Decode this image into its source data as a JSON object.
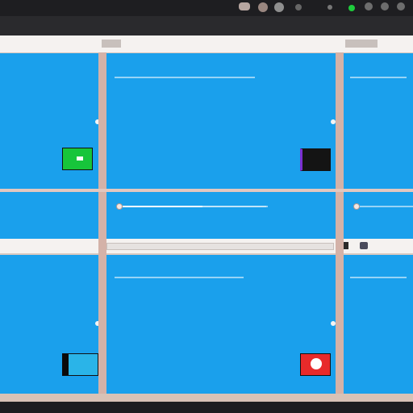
{
  "window": {
    "title_left": "",
    "title_right": ""
  },
  "panes": {
    "top_left": {
      "caption": "",
      "thumb_color": "#17c53b"
    },
    "top_middle": {
      "caption": "",
      "thumb_color": "#141414"
    },
    "bottom_middle": {
      "caption": "",
      "thumb_color": "#e82a2a"
    },
    "bottom_left": {
      "caption": "",
      "thumb_color": "#2ab4e8"
    },
    "right_top": {
      "caption": ""
    },
    "right_bottom": {
      "caption": ""
    }
  },
  "scrubber": {
    "label": "",
    "progress": 0.55
  },
  "toolbar": {
    "label": ""
  },
  "colors": {
    "accent": "#1aa0ec",
    "frame": "#d4b2a8",
    "topbar": "#1e1e21"
  },
  "icons": {
    "window_controls": [
      "minimize-icon",
      "maximize-icon",
      "close-icon"
    ]
  }
}
